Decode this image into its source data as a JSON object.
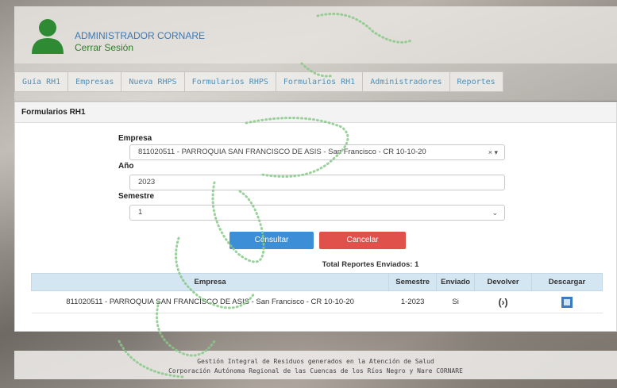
{
  "header": {
    "user_name": "ADMINISTRADOR CORNARE",
    "logout_label": "Cerrar Sesión"
  },
  "nav": {
    "tabs": [
      {
        "label": "Guía RH1"
      },
      {
        "label": "Empresas"
      },
      {
        "label": "Nueva RHPS"
      },
      {
        "label": "Formularios RHPS"
      },
      {
        "label": "Formularios RH1"
      },
      {
        "label": "Administradores"
      },
      {
        "label": "Reportes"
      }
    ]
  },
  "panel": {
    "title": "Formularios RH1",
    "empresa_label": "Empresa",
    "empresa_value": "811020511 - PARROQUIA SAN FRANCISCO DE ASIS - San Francisco - CR 10-10-20",
    "empresa_controls": "× ▾",
    "anio_label": "Año",
    "anio_value": "2023",
    "semestre_label": "Semestre",
    "semestre_value": "1",
    "semestre_caret": "⌄",
    "consult_label": "Consultar",
    "cancel_label": "Cancelar",
    "total_text": "Total Reportes Enviados: 1"
  },
  "table": {
    "headers": [
      "Empresa",
      "Semestre",
      "Enviado",
      "Devolver",
      "Descargar"
    ],
    "rows": [
      {
        "empresa": "811020511 - PARROQUIA SAN FRANCISCO DE ASIS - San Francisco - CR 10-10-20",
        "semestre": "1-2023",
        "enviado": "Si",
        "devolver_icon": "return-icon",
        "descargar_icon": "download-icon"
      }
    ]
  },
  "footer": {
    "line1": "Gestión Integral de Residuos generados en la Atención de Salud",
    "line2": "Corporación Autónoma Regional de las Cuencas de los Ríos Negro y Nare CORNARE"
  },
  "colors": {
    "accent_blue": "#3c8ed6",
    "cancel_red": "#e0514c",
    "logo_green": "#2f7d2a",
    "table_header": "#d5e6f3"
  }
}
